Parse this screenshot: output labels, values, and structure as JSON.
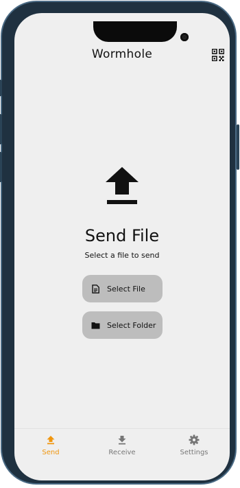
{
  "app": {
    "title": "Wormhole"
  },
  "colors": {
    "accent": "#f0960e",
    "inactive": "#777777",
    "screen_bg": "#efefef",
    "button_bg": "#bdbdbd",
    "frame": "#1f3140"
  },
  "header": {
    "qr_icon": "qr-code-icon"
  },
  "main": {
    "hero_icon": "upload-icon",
    "title": "Send File",
    "subtitle": "Select a file to send",
    "buttons": [
      {
        "label": "Select File",
        "icon": "file-icon"
      },
      {
        "label": "Select Folder",
        "icon": "folder-icon"
      }
    ]
  },
  "nav": {
    "items": [
      {
        "label": "Send",
        "icon": "upload-icon",
        "active": true
      },
      {
        "label": "Receive",
        "icon": "download-icon",
        "active": false
      },
      {
        "label": "Settings",
        "icon": "gear-icon",
        "active": false
      }
    ]
  }
}
